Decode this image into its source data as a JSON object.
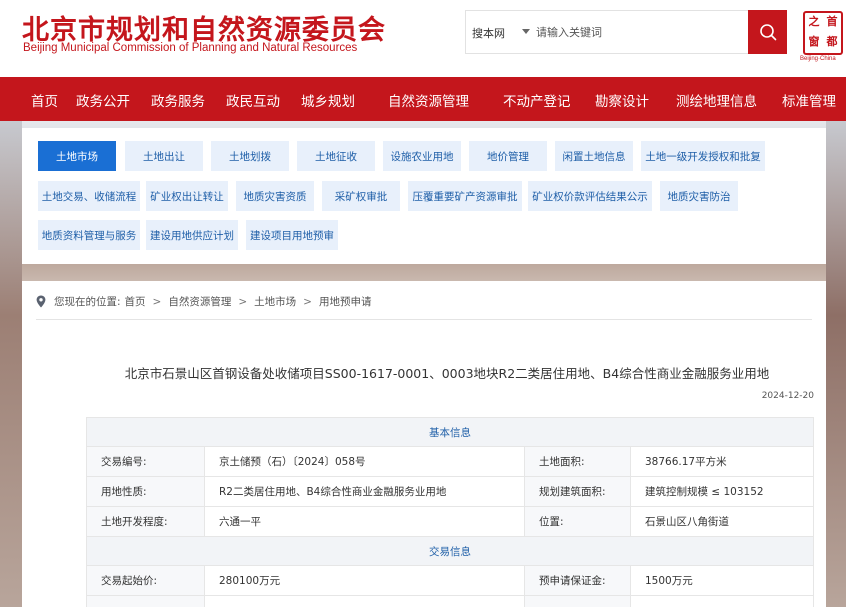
{
  "header": {
    "title_cn": "北京市规划和自然资源委员会",
    "title_en": "Beijing Municipal Commission of Planning and Natural Resources",
    "search_scope": "搜本网",
    "search_placeholder": "请输入关键词",
    "seal_chars": [
      "首",
      "都",
      "之",
      "窗"
    ],
    "seal_en": "Beijing·China",
    "brand_color": "#c4161c"
  },
  "nav": {
    "items": [
      "首页",
      "政务公开",
      "政务服务",
      "政民互动",
      "城乡规划",
      "自然资源管理",
      "不动产登记",
      "勘察设计",
      "测绘地理信息",
      "标准管理"
    ]
  },
  "tabs": {
    "row1": [
      "土地市场",
      "土地出让",
      "土地划拨",
      "土地征收",
      "设施农业用地",
      "地价管理",
      "闲置土地信息",
      "土地一级开发授权和批复"
    ],
    "row2": [
      "土地交易、收储流程",
      "矿业权出让转让",
      "地质灾害资质",
      "采矿权审批",
      "压覆重要矿产资源审批",
      "矿业权价款评估结果公示",
      "地质灾害防治"
    ],
    "row3": [
      "地质资料管理与服务",
      "建设用地供应计划",
      "建设项目用地预审"
    ],
    "active": "土地市场",
    "active_color": "#1a6fd4"
  },
  "breadcrumb": {
    "prefix": "您现在的位置:",
    "items": [
      "首页",
      "自然资源管理",
      "土地市场",
      "用地预申请"
    ]
  },
  "article": {
    "title": "北京市石景山区首钢设备处收储项目SS00-1617-0001、0003地块R2二类居住用地、B4综合性商业金融服务业用地",
    "date": "2024-12-20"
  },
  "table": {
    "section_basic": "基本信息",
    "section_trade": "交易信息",
    "rows_basic": [
      {
        "l1": "交易编号:",
        "v1": "京土储预（石）〔2024〕058号",
        "l2": "土地面积:",
        "v2": "38766.17平方米"
      },
      {
        "l1": "用地性质:",
        "v1": "R2二类居住用地、B4综合性商业金融服务业用地",
        "l2": "规划建筑面积:",
        "v2": "建筑控制规模 ≤ 103152"
      },
      {
        "l1": "土地开发程度:",
        "v1": "六通一平",
        "l2": "位置:",
        "v2": "石景山区八角街道"
      }
    ],
    "rows_trade": [
      {
        "l1": "交易起始价:",
        "v1": "280100万元",
        "l2": "预申请保证金:",
        "v2": "1500万元"
      }
    ]
  }
}
